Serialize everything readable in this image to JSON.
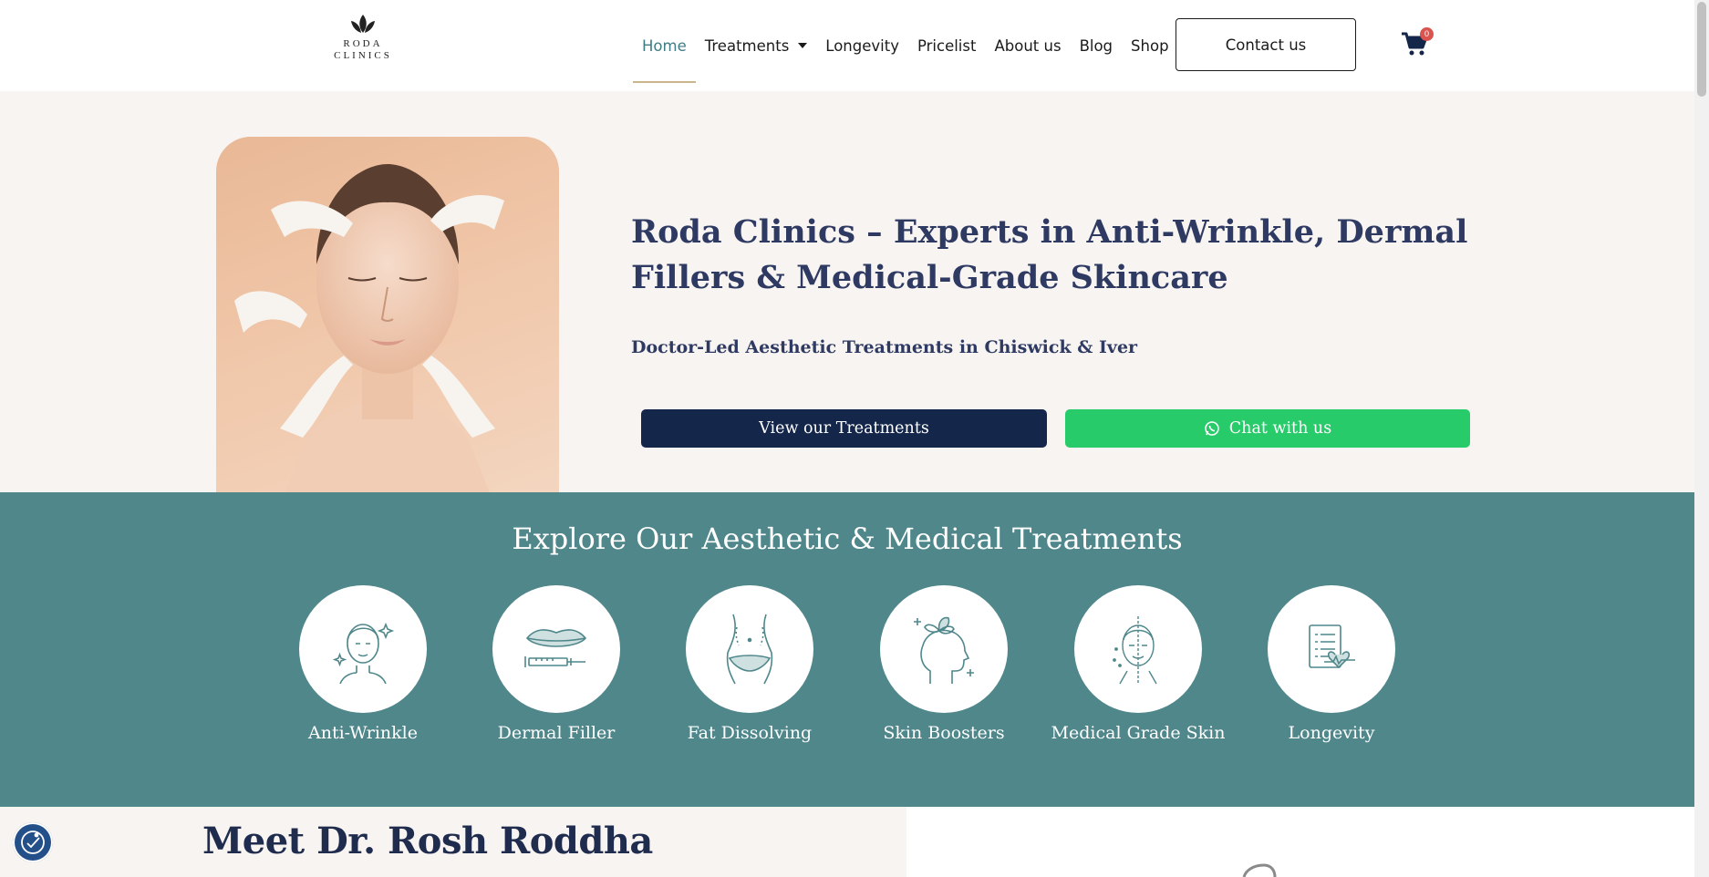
{
  "brand": {
    "logo_line1": "RODA",
    "logo_line2": "CLINICS"
  },
  "nav": {
    "items": [
      {
        "label": "Home",
        "active": true
      },
      {
        "label": "Treatments",
        "has_dropdown": true
      },
      {
        "label": "Longevity"
      },
      {
        "label": "Pricelist"
      },
      {
        "label": "About us"
      },
      {
        "label": "Blog"
      },
      {
        "label": "Shop"
      }
    ],
    "contact_label": "Contact us",
    "cart_count": "0"
  },
  "hero": {
    "title": "Roda Clinics – Experts in Anti-Wrinkle, Dermal Fillers & Medical-Grade Skincare",
    "subtitle": "Doctor-Led Aesthetic Treatments in Chiswick & Iver",
    "btn_treatments": "View our Treatments",
    "btn_chat": "Chat with us"
  },
  "treatments": {
    "title": "Explore Our Aesthetic & Medical Treatments",
    "items": [
      {
        "label": "Anti-Wrinkle",
        "icon": "face-sparkle-icon"
      },
      {
        "label": "Dermal Filler",
        "icon": "lips-syringe-icon"
      },
      {
        "label": "Fat Dissolving",
        "icon": "waist-icon"
      },
      {
        "label": "Skin Boosters",
        "icon": "head-leaf-icon"
      },
      {
        "label": "Medical Grade Skin",
        "icon": "face-half-icon"
      },
      {
        "label": "Longevity",
        "icon": "clipboard-heart-icon"
      }
    ]
  },
  "meet": {
    "title": "Meet Dr. Rosh Roddha"
  },
  "colors": {
    "teal": "#4f878b",
    "navy": "#14264a",
    "whatsapp_green": "#28cb6a",
    "heading": "#2f3a63",
    "cream": "#f7f4f1"
  }
}
